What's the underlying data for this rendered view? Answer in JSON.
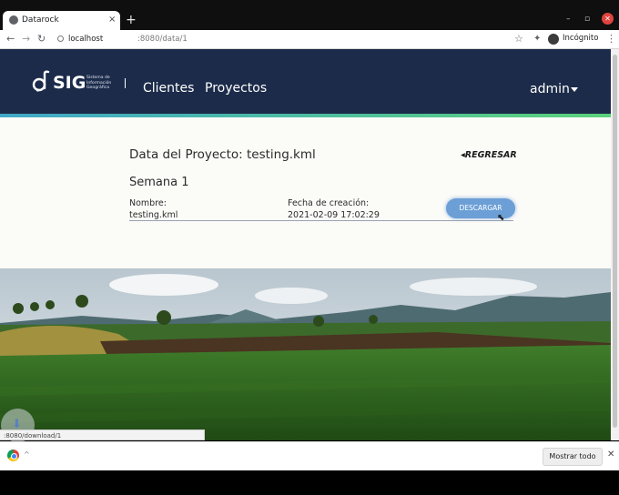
{
  "browser": {
    "tab_title": "Datarock",
    "tab_close": "×",
    "new_tab": "+",
    "window_controls": {
      "minimize": "–",
      "maximize": "▫",
      "close": "✕"
    },
    "nav": {
      "back": "←",
      "forward": "→",
      "reload": "↻"
    },
    "url_host": "localhost",
    "url_path": ":8080/data/1",
    "icons": {
      "star": "☆",
      "extensions": "✦",
      "menu": "⋮"
    },
    "incognito_label": "Incógnito"
  },
  "header": {
    "logo_text": "SIG",
    "logo_subtitle": "Sistema de Información Geográfica",
    "nav_links": [
      "Clientes",
      "Proyectos"
    ],
    "user": "admin"
  },
  "project": {
    "title": "Data del Proyecto: testing.kml",
    "back_label": "REGRESAR",
    "back_arrow": "◂",
    "week": "Semana 1",
    "name_label": "Nombre:",
    "name_value": "testing.kml",
    "date_label": "Fecha de creación:",
    "date_value": "2021-02-09 17:02:29",
    "download_label": "DESCARGAR"
  },
  "status_url": ":8080/download/1",
  "download_shelf": {
    "show_all": "Mostrar todo",
    "close": "✕",
    "chevron": "^"
  },
  "colors": {
    "navbar": "#1c2b4a",
    "accent_stripe_start": "#3fa8c8",
    "accent_stripe_end": "#5bd27a",
    "button": "#6c9fd6"
  }
}
